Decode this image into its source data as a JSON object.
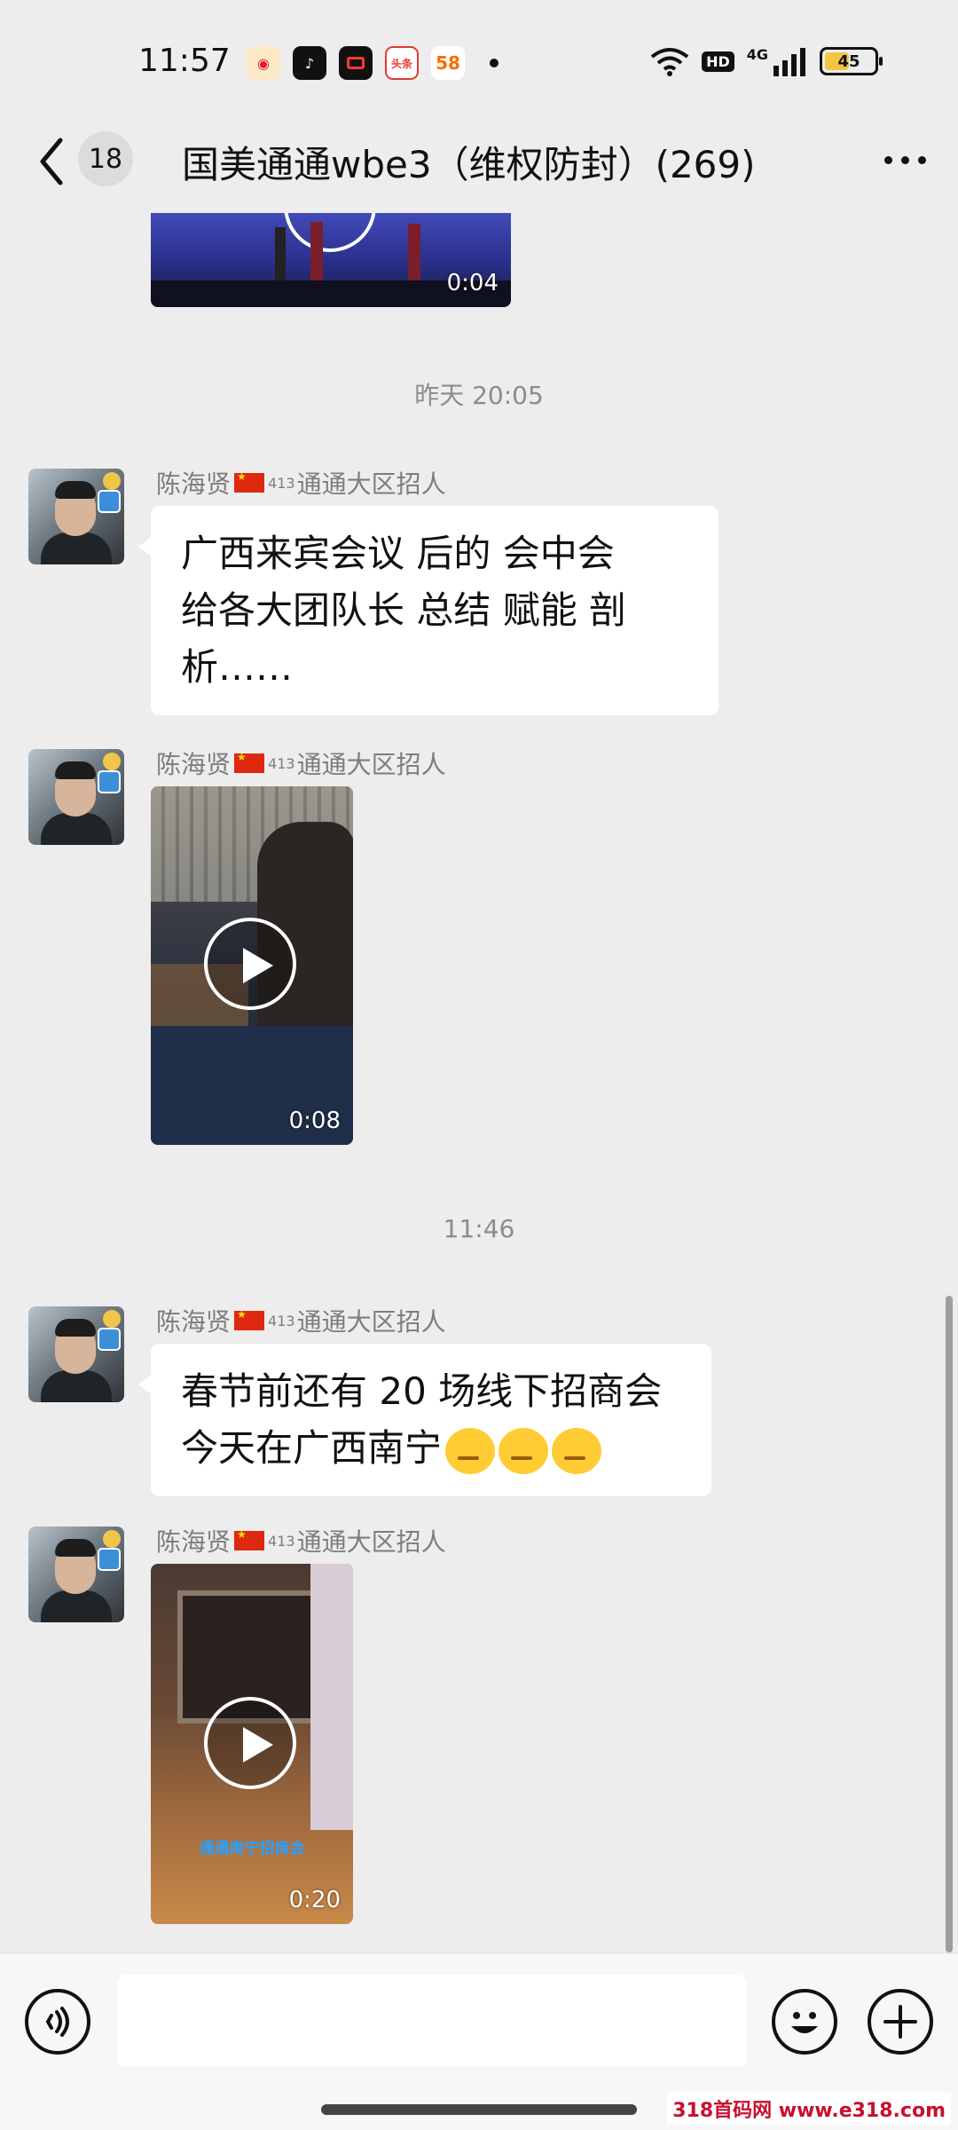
{
  "status_bar": {
    "time": "11:57",
    "app_icons": [
      "weibo-icon",
      "tiktok-icon",
      "video-record-icon",
      "toutiao-icon",
      "app-58-icon"
    ],
    "app_labels": {
      "toutiao": "头条",
      "app58": "58"
    },
    "network": "4G",
    "hd_label": "HD",
    "battery": "45"
  },
  "header": {
    "unread_count": "18",
    "title": "国美通通wbe3（维权防封）(269)"
  },
  "messages": [
    {
      "type": "video",
      "duration": "0:04"
    },
    {
      "type": "timestamp",
      "text": "昨天  20:05"
    },
    {
      "type": "text",
      "sender": "陈海贤",
      "sender_suffix": "通通大区招人",
      "sender_sup": "413",
      "lines": [
        "广西来宾会议  后的  会中会",
        "给各大团队长  总结  赋能  剖",
        "析……"
      ]
    },
    {
      "type": "video",
      "sender": "陈海贤",
      "sender_suffix": "通通大区招人",
      "sender_sup": "413",
      "duration": "0:08"
    },
    {
      "type": "timestamp",
      "text": "11:46"
    },
    {
      "type": "text",
      "sender": "陈海贤",
      "sender_suffix": "通通大区招人",
      "sender_sup": "413",
      "lines": [
        "春节前还有 20 场线下招商会",
        "今天在广西南宁"
      ]
    },
    {
      "type": "video",
      "sender": "陈海贤",
      "sender_suffix": "通通大区招人",
      "sender_sup": "413",
      "duration": "0:20",
      "caption": "通通南宁招商会"
    }
  ],
  "watermark": "318首码网 www.e318.com"
}
